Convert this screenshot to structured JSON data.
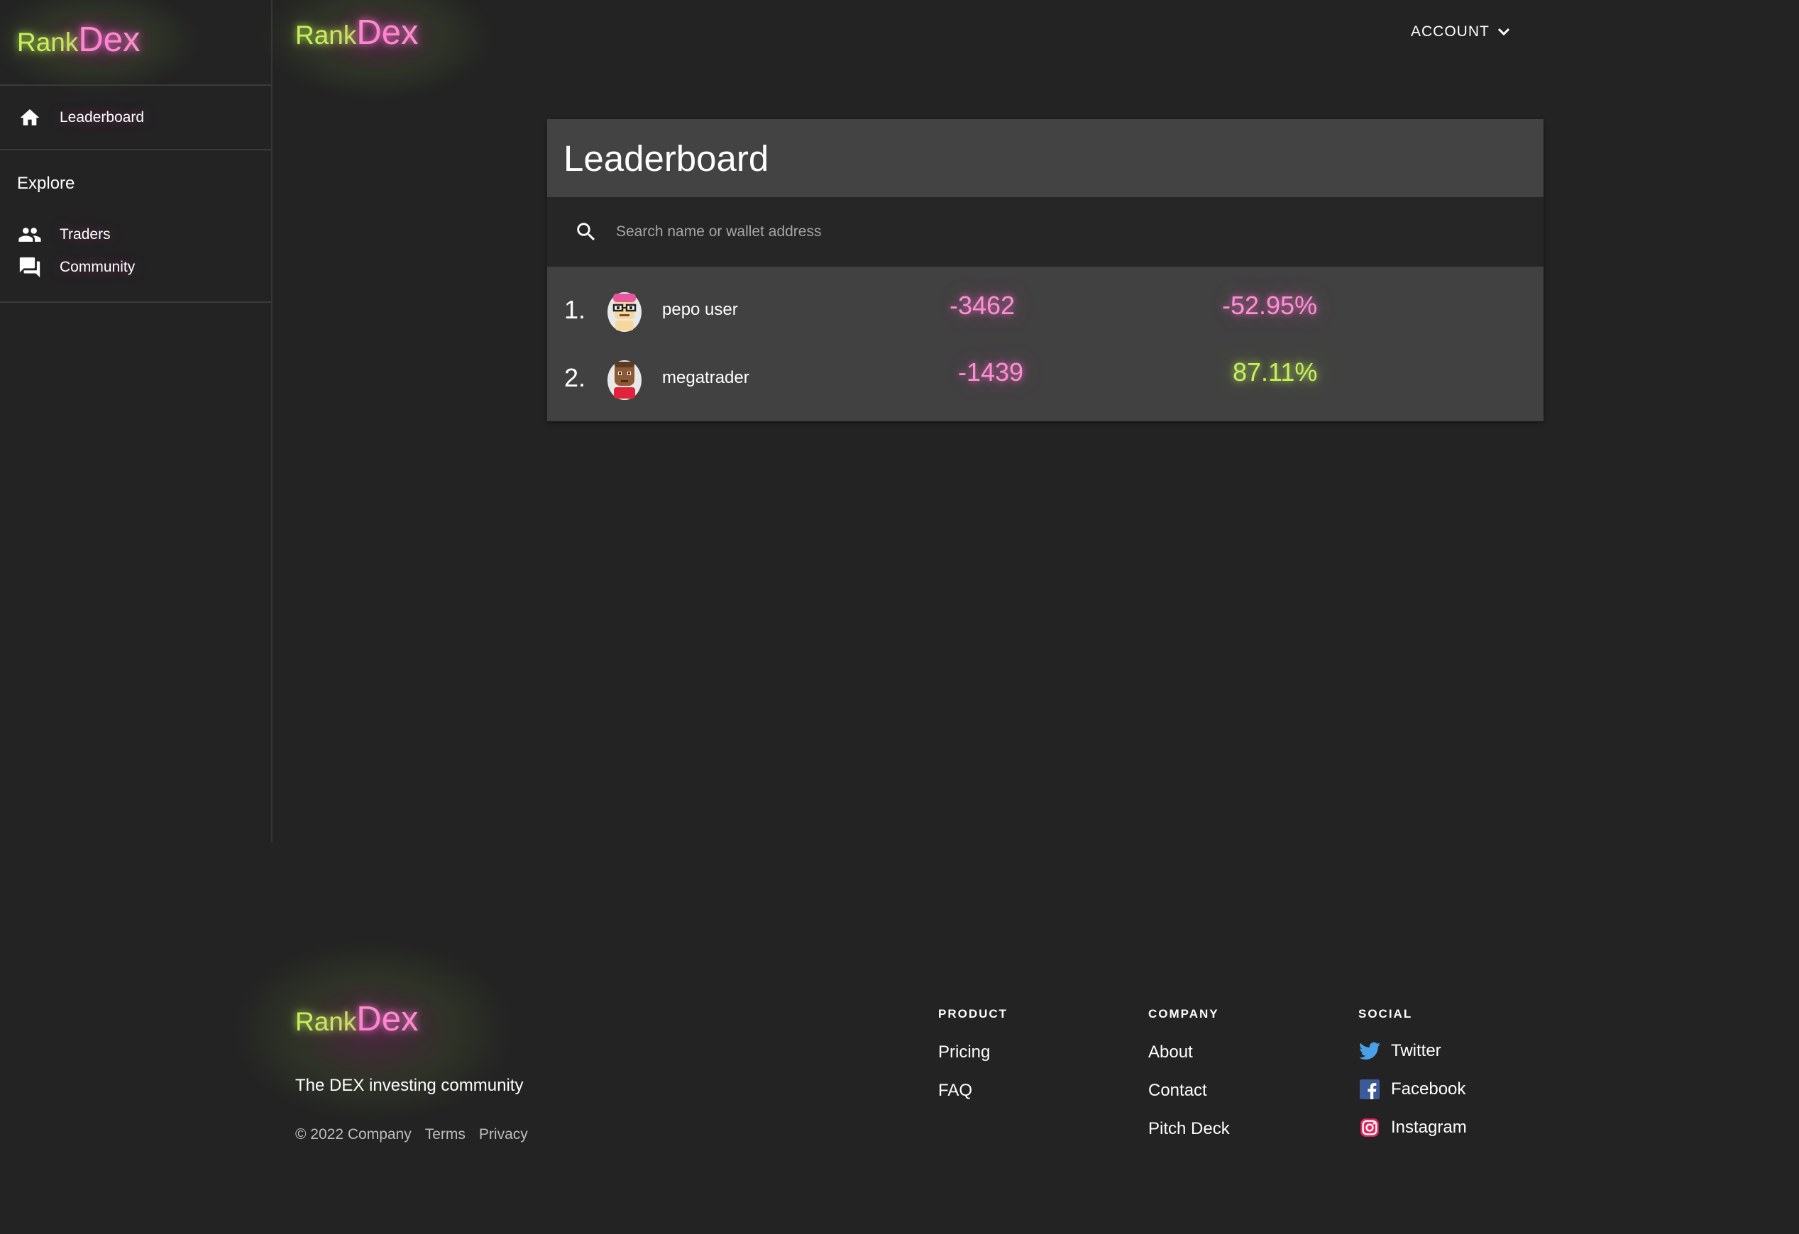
{
  "brand": {
    "rank": "Rank",
    "dex": "Dex"
  },
  "sidebar": {
    "nav": [
      {
        "label": "Leaderboard",
        "icon": "home-icon"
      }
    ],
    "explore_heading": "Explore",
    "explore": [
      {
        "label": "Traders",
        "icon": "people-icon"
      },
      {
        "label": "Community",
        "icon": "forum-icon"
      }
    ]
  },
  "header": {
    "account_label": "ACCOUNT",
    "account_icon": "chevron-down-icon"
  },
  "leaderboard": {
    "title": "Leaderboard",
    "search_placeholder": "Search name or wallet address",
    "rows": [
      {
        "rank": "1.",
        "name": "pepo user",
        "score": "-3462",
        "change": "-52.95%",
        "score_color": "#ff8fd4",
        "change_color": "#ff8fd4"
      },
      {
        "rank": "2.",
        "name": "megatrader",
        "score": "-1439",
        "change": "87.11%",
        "score_color": "#ff8fd4",
        "change_color": "#c6f25a"
      }
    ]
  },
  "footer": {
    "tagline": "The DEX investing community",
    "copyright": "© 2022 Company",
    "terms": "Terms",
    "privacy": "Privacy",
    "columns": {
      "product": {
        "title": "PRODUCT",
        "links": [
          "Pricing",
          "FAQ"
        ]
      },
      "company": {
        "title": "COMPANY",
        "links": [
          "About",
          "Contact",
          "Pitch Deck"
        ]
      },
      "social": {
        "title": "SOCIAL",
        "links": [
          {
            "label": "Twitter",
            "icon": "twitter-icon"
          },
          {
            "label": "Facebook",
            "icon": "facebook-icon"
          },
          {
            "label": "Instagram",
            "icon": "instagram-icon"
          }
        ]
      }
    }
  },
  "colors": {
    "background": "#232323",
    "card_header": "#434343",
    "rows_bg": "#414141",
    "accent_green": "#c6f25a",
    "accent_pink": "#ff8fd4"
  }
}
